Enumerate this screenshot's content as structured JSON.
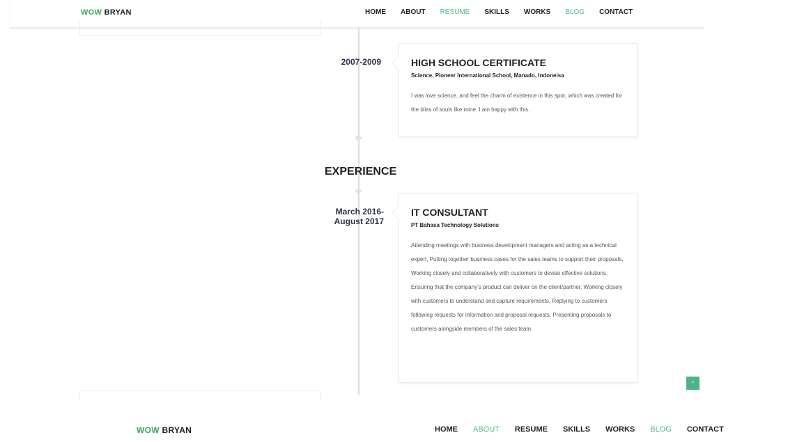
{
  "header": {
    "logo_a": "WOW",
    "logo_b": " BRYAN",
    "nav": [
      "HOME",
      "ABOUT",
      "RESUME",
      "SKILLS",
      "WORKS",
      "BLOG",
      "CONTACT"
    ]
  },
  "education": {
    "date": "2007-2009",
    "title": "HIGH SCHOOL CERTIFICATE",
    "subtitle": "Science, Pioneer International School, Manado, Indoneisa",
    "description": "I was love science, and feel the charm of existence in this spot, which was created for the bliss of souls like mine. I am happy with this."
  },
  "experience": {
    "section_title": "EXPERIENCE",
    "date_line1": "March 2016-",
    "date_line2": "August 2017",
    "title": "IT CONSULTANT",
    "subtitle": "PT Bahasa Technology Solutions",
    "description": "Attending meetings with business development managers and acting as a technical expert, Putting together business cases for the sales teams to support their proposals, Working closely and collaboratively with customers to devise effective solutions, Ensuring that the company's product can deliver on the client/partner, Working closely with customers to understand and capture requirements, Replying to customers following requests for information and proposal requests, Presenting proposals to customers alongside members of the sales team."
  },
  "footer": {
    "logo_a": "WOW",
    "logo_b": " BRYAN",
    "nav": [
      "HOME",
      "ABOUT",
      "RESUME",
      "SKILLS",
      "WORKS",
      "BLOG",
      "CONTACT"
    ]
  },
  "scroll_top": {
    "icon": "chevron-up-icon",
    "glyph": "^"
  },
  "colors": {
    "accent": "#4ebc86",
    "logo_green": "#3aa55d",
    "date_text": "#2b3148",
    "scroll_button": "#4eb38b"
  }
}
